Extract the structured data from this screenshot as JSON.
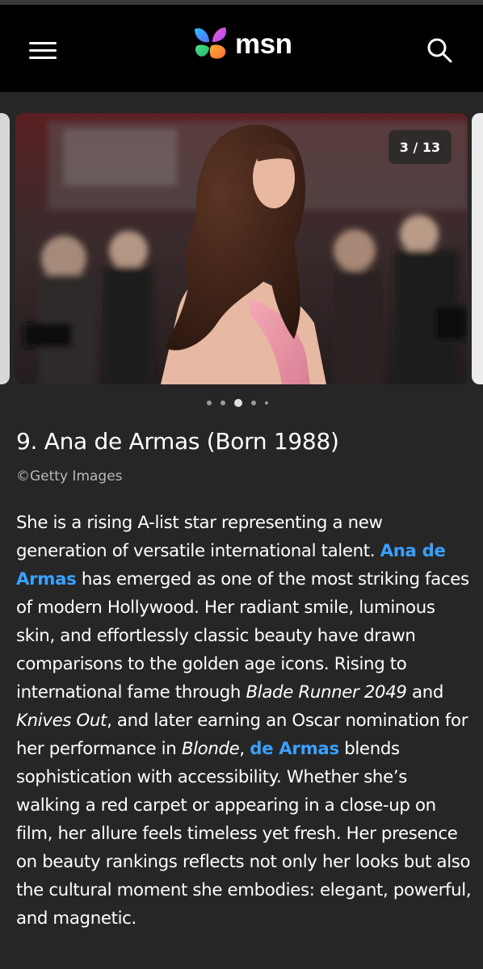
{
  "header": {
    "logo_text": "msn",
    "menu_icon": "hamburger-menu-icon",
    "search_icon": "search-icon"
  },
  "gallery": {
    "counter": "3 / 13",
    "active_dot_index": 2,
    "dot_count": 5
  },
  "article": {
    "title": "9. Ana de Armas (Born 1988)",
    "credit": "©Getty Images",
    "paragraph": {
      "t1": "She is a rising A-list star representing a new generation of versatile international talent. ",
      "link1": "Ana de Armas",
      "t2": " has emerged as one of the most striking faces of modern Hollywood. Her radiant smile, luminous skin, and effortlessly classic beauty have drawn comparisons to the golden age icons. Rising to international fame through ",
      "film1": "Blade Runner 2049",
      "t3": " and ",
      "film2": "Knives Out",
      "t4": ", and later earning an Oscar nomination for her performance in ",
      "film3": "Blonde",
      "t5": ", ",
      "link2": "de Armas",
      "t6": " blends sophistication with accessibility. Whether she’s walking a red carpet or appearing in a close-up on film, her allure feels timeless yet fresh. Her presence on beauty rankings reflects not only her looks but also the cultural moment she embodies: elegant, powerful, and magnetic."
    }
  },
  "colors": {
    "background": "#262626",
    "header": "#000000",
    "link": "#3aa0ff"
  }
}
